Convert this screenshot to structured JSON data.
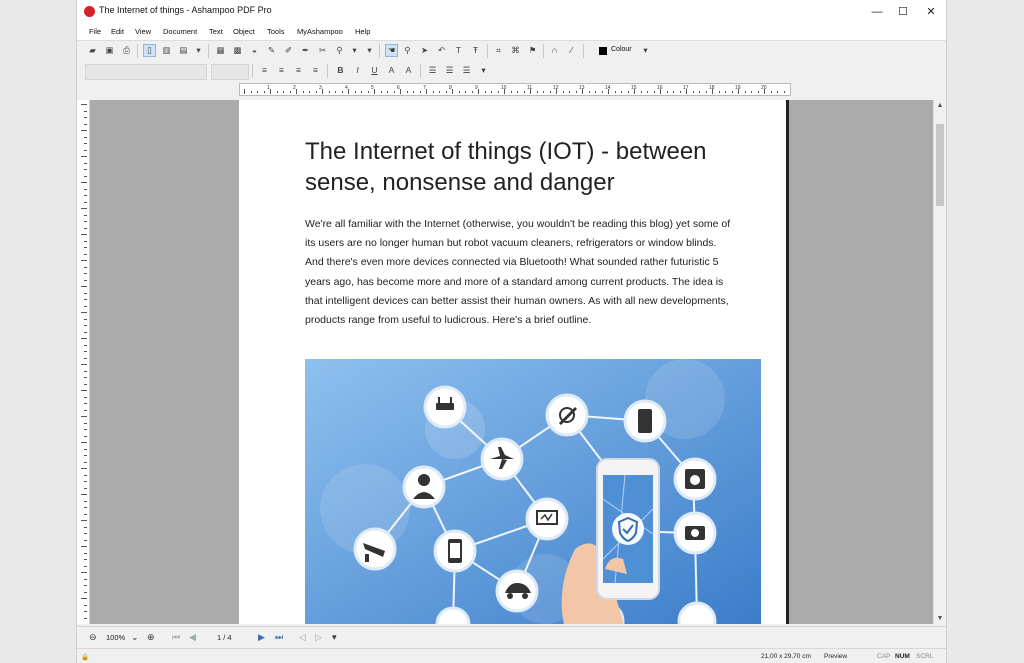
{
  "window": {
    "title": "The Internet of things - Ashampoo PDF Pro",
    "minimize": "—",
    "maximize": "☐",
    "close": "✕"
  },
  "menu": [
    "File",
    "Edit",
    "View",
    "Document",
    "Text",
    "Object",
    "Tools",
    "MyAshampoo",
    "Help"
  ],
  "toolbar": {
    "colour_label": "Colour"
  },
  "document": {
    "title": "The Internet of things (IOT) - between sense, nonsense and danger",
    "body": "We're all familiar with the Internet (otherwise, you wouldn't be reading this blog) yet some of its users are no longer human but robot vacuum cleaners, refrigerators or window blinds. And there's even more devices connected via Bluetooth! What sounded rather futuristic 5 years ago, has become more and more of a standard among current products. The idea is that intelligent devices can better assist their human owners. As with all new developments, products range from useful to ludicrous. Here's a brief outline."
  },
  "navigation": {
    "zoom": "100%",
    "page": "1 / 4"
  },
  "status": {
    "page_size": "21,00 x 29,70 cm",
    "mode": "Preview",
    "cap": "CAP",
    "num": "NUM",
    "scrl": "SCRL"
  },
  "ruler": [
    "1",
    "2",
    "3",
    "4",
    "5",
    "6",
    "7",
    "8",
    "9",
    "10",
    "11",
    "12",
    "13",
    "14",
    "15",
    "16",
    "17",
    "18",
    "19",
    "20"
  ],
  "colors": {
    "accent": "#3a6db0",
    "image_bg": "#5d9ad8",
    "logo": "#d62027"
  },
  "image_icons": [
    "router-icon",
    "satellite-dish-icon",
    "fridge-icon",
    "airplane-icon",
    "user-icon",
    "washing-machine-icon",
    "monitor-icon",
    "shield-icon",
    "camera-icon",
    "security-camera-icon",
    "phone-icon",
    "car-icon"
  ]
}
